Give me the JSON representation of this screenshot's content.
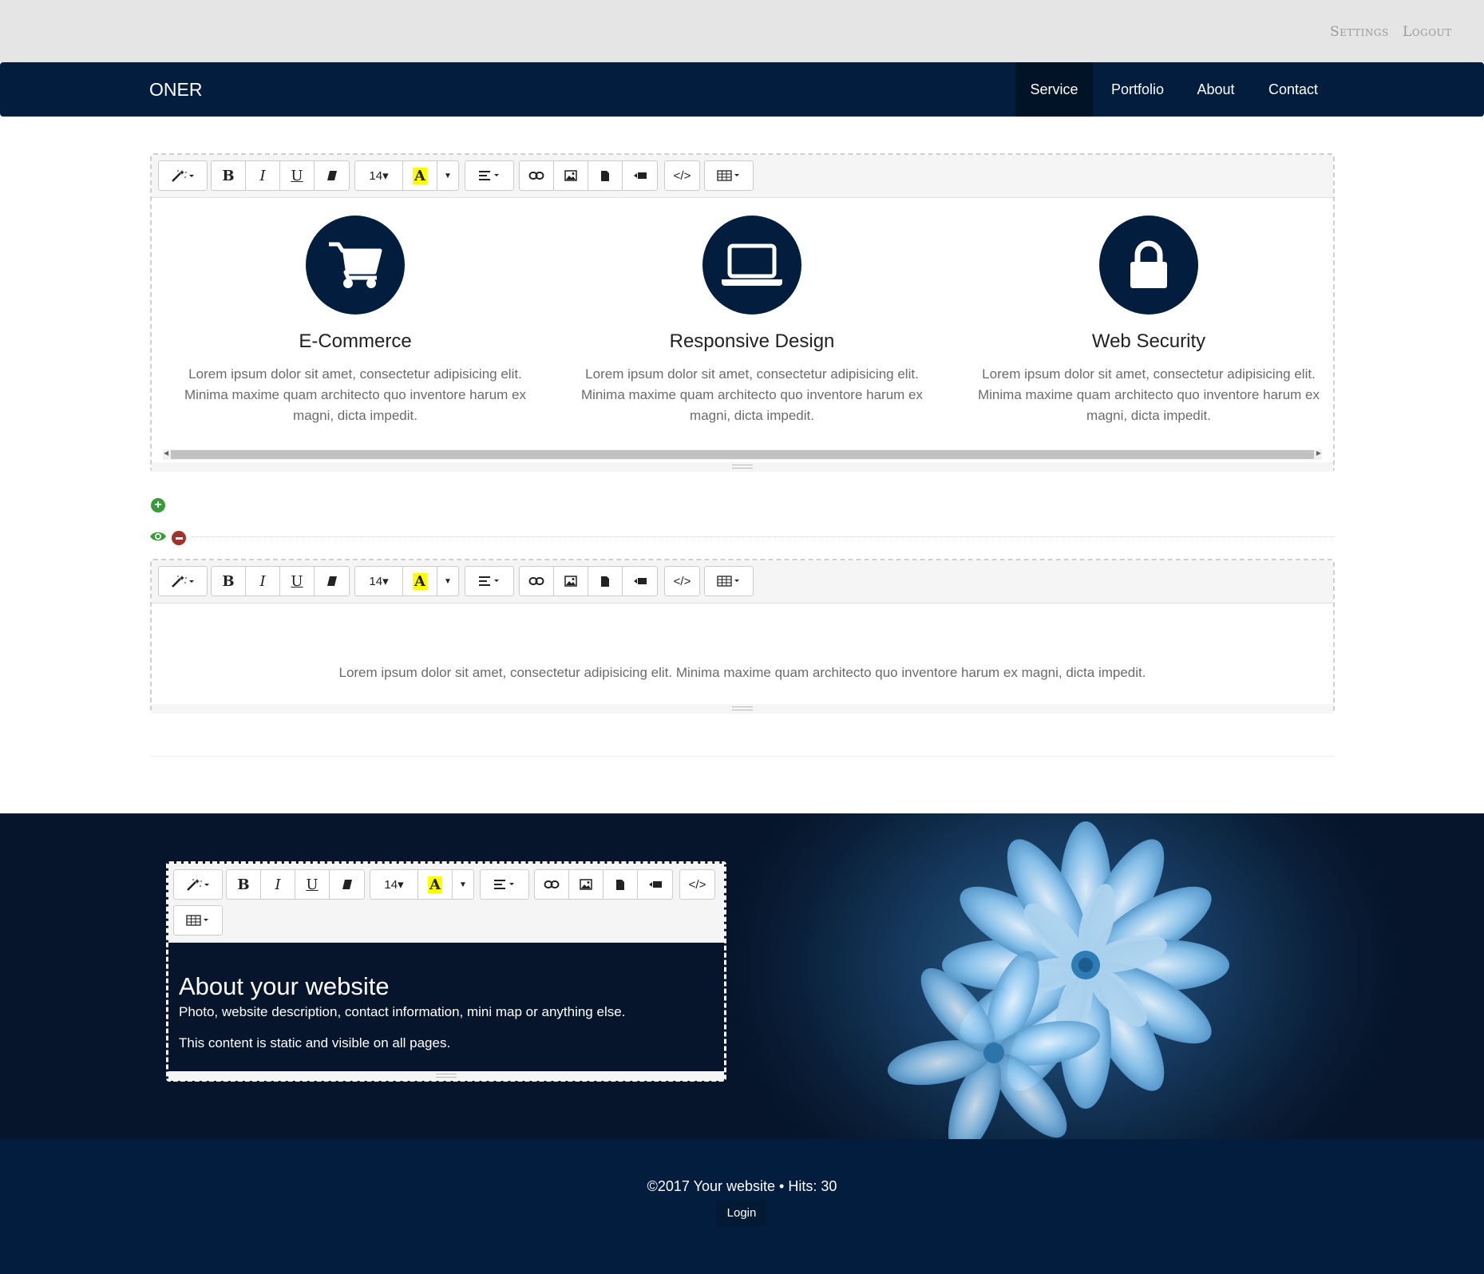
{
  "admin": {
    "settings": "Settings",
    "logout": "Logout"
  },
  "navbar": {
    "brand": "ONER",
    "items": [
      {
        "label": "Service",
        "active": true
      },
      {
        "label": "Portfolio"
      },
      {
        "label": "About"
      },
      {
        "label": "Contact"
      }
    ]
  },
  "toolbar": {
    "bold": "B",
    "italic": "I",
    "underline": "U",
    "font_size": "14▾",
    "color_letter": "A",
    "code": "</>"
  },
  "services": [
    {
      "icon": "shopping-cart-icon",
      "title": "E-Commerce",
      "text": "Lorem ipsum dolor sit amet, consectetur adipisicing elit. Minima maxime quam architecto quo inventore harum ex magni, dicta impedit."
    },
    {
      "icon": "laptop-icon",
      "title": "Responsive Design",
      "text": "Lorem ipsum dolor sit amet, consectetur adipisicing elit. Minima maxime quam architecto quo inventore harum ex magni, dicta impedit."
    },
    {
      "icon": "lock-icon",
      "title": "Web Security",
      "text": "Lorem ipsum dolor sit amet, consectetur adipisicing elit. Minima maxime quam architecto quo inventore harum ex magni, dicta impedit."
    }
  ],
  "second_editor": {
    "text": "Lorem ipsum dolor sit amet, consectetur adipisicing elit. Minima maxime quam architecto quo inventore harum ex magni, dicta impedit."
  },
  "about": {
    "title": "About your website",
    "line1": "Photo, website description, contact information, mini map or anything else.",
    "line2": "This content is static and visible on all pages."
  },
  "footer": {
    "copyright": "©2017 Your website • Hits: 30",
    "login": "Login"
  },
  "colors": {
    "navy": "#021d3e",
    "add_green": "#3a9a3a",
    "remove_red": "#a0332b",
    "highlight_yellow": "#ffff00"
  }
}
